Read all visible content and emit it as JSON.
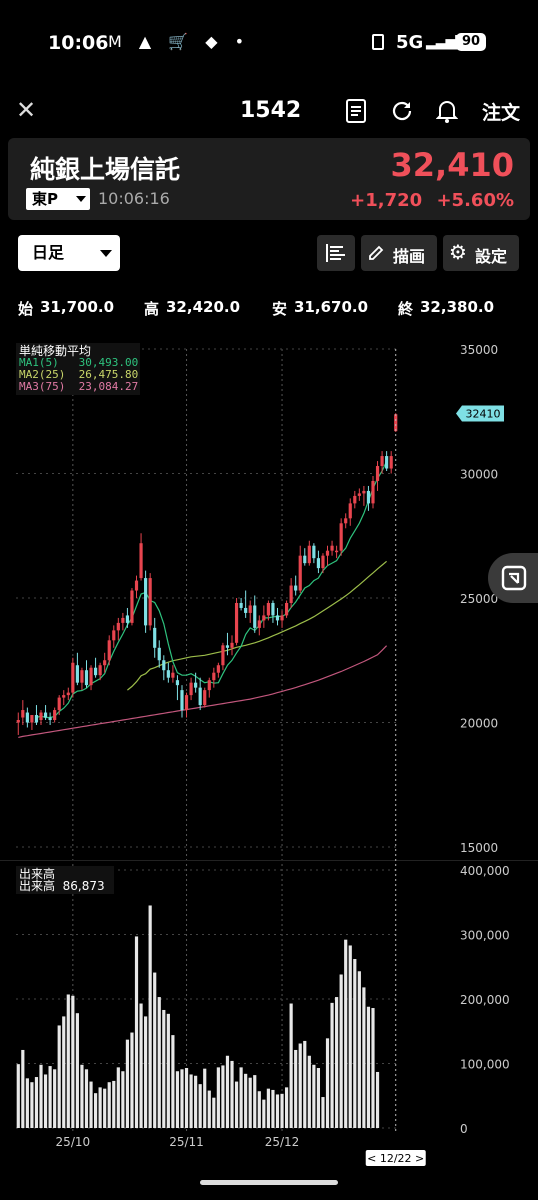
{
  "status_bar": {
    "time": "10:06",
    "network": "5G",
    "battery": "90"
  },
  "nav": {
    "code": "1542",
    "order_label": "注文"
  },
  "quote": {
    "name": "純銀上場信託",
    "price": "32,410",
    "change": "+1,720",
    "change_pct": "+5.60%",
    "market": "東P",
    "time": "10:06:16"
  },
  "toolbar": {
    "period": "日足",
    "draw_label": "描画",
    "settings_label": "設定"
  },
  "ohlc": {
    "open_label": "始",
    "open": "31,700.0",
    "high_label": "高",
    "high": "32,420.0",
    "low_label": "安",
    "low": "31,670.0",
    "close_label": "終",
    "close": "32,380.0"
  },
  "price_legend": {
    "title": "単純移動平均",
    "ma1": "MA1(5)   30,493.00",
    "ma2": "MA2(25)  26,475.80",
    "ma3": "MA3(75)  23,084.27"
  },
  "volume_legend": {
    "title": "出来高",
    "line": "出来高  86,873"
  },
  "price_tag": "32410",
  "date_tag": "< 12/22 >",
  "colors": {
    "up": "#e8454f",
    "down": "#7fe0e5",
    "ma1": "#2ec27e",
    "ma2": "#9cbd4a",
    "ma3": "#c2577d",
    "volume": "#e8e8e8"
  },
  "chart_data": {
    "type": "candlestick",
    "price_axis": {
      "ylim": [
        15000,
        35000
      ],
      "ticks": [
        "35000",
        "30000",
        "25000",
        "20000",
        "15000"
      ]
    },
    "volume_axis": {
      "ylim": [
        0,
        400000
      ],
      "ticks": [
        "400,000",
        "300,000",
        "200,000",
        "100,000",
        "0"
      ]
    },
    "x_ticks": [
      {
        "label": "25/10",
        "index": 12
      },
      {
        "label": "25/11",
        "index": 37
      },
      {
        "label": "25/12",
        "index": 58
      }
    ],
    "candles": [
      {
        "o": 20000,
        "h": 20400,
        "l": 19500,
        "c": 20100
      },
      {
        "o": 20200,
        "h": 20900,
        "l": 19900,
        "c": 20500
      },
      {
        "o": 20400,
        "h": 20600,
        "l": 19800,
        "c": 20000
      },
      {
        "o": 20000,
        "h": 20300,
        "l": 19700,
        "c": 20300
      },
      {
        "o": 20300,
        "h": 20700,
        "l": 19900,
        "c": 20000
      },
      {
        "o": 20100,
        "h": 20500,
        "l": 19900,
        "c": 20400
      },
      {
        "o": 20400,
        "h": 20700,
        "l": 20100,
        "c": 20200
      },
      {
        "o": 20200,
        "h": 20400,
        "l": 19900,
        "c": 20100
      },
      {
        "o": 20100,
        "h": 20600,
        "l": 20000,
        "c": 20500
      },
      {
        "o": 20500,
        "h": 21100,
        "l": 20300,
        "c": 21000
      },
      {
        "o": 21000,
        "h": 21300,
        "l": 20700,
        "c": 21100
      },
      {
        "o": 21100,
        "h": 21400,
        "l": 20900,
        "c": 21200
      },
      {
        "o": 21200,
        "h": 22600,
        "l": 21000,
        "c": 22400
      },
      {
        "o": 22300,
        "h": 22800,
        "l": 21500,
        "c": 21600
      },
      {
        "o": 21600,
        "h": 22200,
        "l": 21300,
        "c": 22100
      },
      {
        "o": 22100,
        "h": 22500,
        "l": 21400,
        "c": 21500
      },
      {
        "o": 21500,
        "h": 22300,
        "l": 21300,
        "c": 22200
      },
      {
        "o": 22200,
        "h": 22600,
        "l": 21800,
        "c": 21900
      },
      {
        "o": 21900,
        "h": 22400,
        "l": 21700,
        "c": 22300
      },
      {
        "o": 22300,
        "h": 22800,
        "l": 22000,
        "c": 22500
      },
      {
        "o": 22500,
        "h": 23500,
        "l": 22300,
        "c": 23300
      },
      {
        "o": 23300,
        "h": 23900,
        "l": 23000,
        "c": 23700
      },
      {
        "o": 23700,
        "h": 24200,
        "l": 23300,
        "c": 24000
      },
      {
        "o": 24000,
        "h": 24400,
        "l": 23700,
        "c": 24200
      },
      {
        "o": 24300,
        "h": 24600,
        "l": 23800,
        "c": 24000
      },
      {
        "o": 24000,
        "h": 25400,
        "l": 23900,
        "c": 25300
      },
      {
        "o": 25300,
        "h": 25900,
        "l": 25000,
        "c": 25700
      },
      {
        "o": 25800,
        "h": 27600,
        "l": 25700,
        "c": 27200
      },
      {
        "o": 25800,
        "h": 26100,
        "l": 23600,
        "c": 23900
      },
      {
        "o": 23900,
        "h": 26000,
        "l": 23700,
        "c": 25800
      },
      {
        "o": 23800,
        "h": 24200,
        "l": 22600,
        "c": 23000
      },
      {
        "o": 23000,
        "h": 23300,
        "l": 22200,
        "c": 22500
      },
      {
        "o": 22500,
        "h": 22700,
        "l": 21700,
        "c": 22100
      },
      {
        "o": 22100,
        "h": 22400,
        "l": 21600,
        "c": 21800
      },
      {
        "o": 21800,
        "h": 22300,
        "l": 21600,
        "c": 22000
      },
      {
        "o": 21700,
        "h": 21900,
        "l": 20900,
        "c": 21500
      },
      {
        "o": 21300,
        "h": 21500,
        "l": 20200,
        "c": 20500
      },
      {
        "o": 20500,
        "h": 21200,
        "l": 20200,
        "c": 21100
      },
      {
        "o": 21100,
        "h": 21800,
        "l": 20900,
        "c": 21600
      },
      {
        "o": 21600,
        "h": 22000,
        "l": 21200,
        "c": 21400
      },
      {
        "o": 21400,
        "h": 21800,
        "l": 20500,
        "c": 20700
      },
      {
        "o": 20700,
        "h": 21400,
        "l": 20600,
        "c": 21300
      },
      {
        "o": 21300,
        "h": 21800,
        "l": 21000,
        "c": 21700
      },
      {
        "o": 21700,
        "h": 22200,
        "l": 21400,
        "c": 22000
      },
      {
        "o": 22000,
        "h": 22400,
        "l": 21800,
        "c": 22300
      },
      {
        "o": 22300,
        "h": 23200,
        "l": 22100,
        "c": 23100
      },
      {
        "o": 23100,
        "h": 23600,
        "l": 22700,
        "c": 23000
      },
      {
        "o": 23000,
        "h": 23500,
        "l": 22700,
        "c": 23200
      },
      {
        "o": 23200,
        "h": 25000,
        "l": 23100,
        "c": 24800
      },
      {
        "o": 24800,
        "h": 25000,
        "l": 24500,
        "c": 24600
      },
      {
        "o": 24600,
        "h": 25300,
        "l": 24200,
        "c": 24400
      },
      {
        "o": 24400,
        "h": 24900,
        "l": 24000,
        "c": 24700
      },
      {
        "o": 24700,
        "h": 25100,
        "l": 23600,
        "c": 23800
      },
      {
        "o": 23800,
        "h": 24300,
        "l": 23500,
        "c": 24100
      },
      {
        "o": 24100,
        "h": 24700,
        "l": 23800,
        "c": 24300
      },
      {
        "o": 24300,
        "h": 24900,
        "l": 24100,
        "c": 24800
      },
      {
        "o": 24800,
        "h": 24900,
        "l": 24000,
        "c": 24300
      },
      {
        "o": 24300,
        "h": 24600,
        "l": 23900,
        "c": 24100
      },
      {
        "o": 24100,
        "h": 24500,
        "l": 23800,
        "c": 24300
      },
      {
        "o": 24300,
        "h": 24900,
        "l": 24200,
        "c": 24800
      },
      {
        "o": 24800,
        "h": 25800,
        "l": 24600,
        "c": 25500
      },
      {
        "o": 25500,
        "h": 25900,
        "l": 25100,
        "c": 25300
      },
      {
        "o": 25300,
        "h": 27100,
        "l": 25200,
        "c": 26700
      },
      {
        "o": 26700,
        "h": 27000,
        "l": 26300,
        "c": 26400
      },
      {
        "o": 26400,
        "h": 27300,
        "l": 26300,
        "c": 27100
      },
      {
        "o": 27100,
        "h": 27200,
        "l": 26400,
        "c": 26600
      },
      {
        "o": 26600,
        "h": 26900,
        "l": 26000,
        "c": 26200
      },
      {
        "o": 26200,
        "h": 26800,
        "l": 26000,
        "c": 26700
      },
      {
        "o": 26700,
        "h": 27100,
        "l": 26300,
        "c": 26900
      },
      {
        "o": 26900,
        "h": 27300,
        "l": 26700,
        "c": 27100
      },
      {
        "o": 26900,
        "h": 27100,
        "l": 26600,
        "c": 26900
      },
      {
        "o": 26900,
        "h": 28200,
        "l": 26700,
        "c": 28000
      },
      {
        "o": 28000,
        "h": 28400,
        "l": 27800,
        "c": 28200
      },
      {
        "o": 28200,
        "h": 29000,
        "l": 27900,
        "c": 28800
      },
      {
        "o": 28800,
        "h": 29300,
        "l": 28600,
        "c": 29100
      },
      {
        "o": 29100,
        "h": 29400,
        "l": 28900,
        "c": 29200
      },
      {
        "o": 29200,
        "h": 29500,
        "l": 28700,
        "c": 29300
      },
      {
        "o": 29300,
        "h": 29500,
        "l": 28500,
        "c": 28800
      },
      {
        "o": 28800,
        "h": 29900,
        "l": 28600,
        "c": 29700
      },
      {
        "o": 29700,
        "h": 30500,
        "l": 29300,
        "c": 30300
      },
      {
        "o": 30300,
        "h": 30900,
        "l": 30000,
        "c": 30700
      },
      {
        "o": 30700,
        "h": 30900,
        "l": 30100,
        "c": 30200
      },
      {
        "o": 30200,
        "h": 30900,
        "l": 30000,
        "c": 30700
      },
      {
        "o": 31700,
        "h": 32420,
        "l": 31670,
        "c": 32380
      }
    ],
    "volume": [
      99000,
      121000,
      77000,
      71000,
      79000,
      98000,
      83000,
      96000,
      91000,
      159000,
      173000,
      207000,
      205000,
      178000,
      98000,
      91000,
      72000,
      54000,
      63000,
      61000,
      71000,
      73000,
      94000,
      88000,
      137000,
      148000,
      297000,
      193000,
      173000,
      345000,
      241000,
      203000,
      183000,
      177000,
      144000,
      88000,
      91000,
      93000,
      83000,
      81000,
      68000,
      92000,
      58000,
      47000,
      94000,
      97000,
      112000,
      104000,
      72000,
      94000,
      84000,
      78000,
      82000,
      57000,
      44000,
      61000,
      59000,
      52000,
      53000,
      63000,
      193000,
      121000,
      131000,
      135000,
      112000,
      98000,
      93000,
      48000,
      139000,
      194000,
      203000,
      238000,
      292000,
      283000,
      262000,
      243000,
      218000,
      188000,
      186000,
      86873
    ],
    "ma1": [
      null,
      null,
      null,
      null,
      20200,
      20260,
      20200,
      20200,
      20240,
      20440,
      20580,
      20780,
      21140,
      21260,
      21280,
      21380,
      21560,
      21660,
      21760,
      21960,
      22440,
      22860,
      23220,
      23560,
      23920,
      24200,
      24680,
      25160,
      25220,
      24900,
      24820,
      24480,
      23960,
      23160,
      22440,
      22000,
      21900,
      21900,
      21960,
      21860,
      21720,
      21600,
      21640,
      21580,
      21600,
      21960,
      22300,
      22500,
      22800,
      23060,
      23540,
      23800,
      23700,
      23900,
      24200,
      24200,
      24240,
      24260,
      24260,
      24360,
      24620,
      24840,
      25120,
      25400,
      25500,
      25700,
      25800,
      26100,
      26300,
      26400,
      26500,
      26800,
      27000,
      27400,
      27700,
      28000,
      28400,
      28900,
      29400,
      29800,
      30100,
      30493
    ],
    "ma2": [
      null,
      null,
      null,
      null,
      null,
      null,
      null,
      null,
      null,
      null,
      null,
      null,
      null,
      null,
      null,
      null,
      null,
      null,
      null,
      null,
      null,
      null,
      null,
      null,
      21300,
      21450,
      21640,
      21880,
      21960,
      22140,
      22200,
      22280,
      22360,
      22420,
      22480,
      22520,
      22560,
      22600,
      22640,
      22660,
      22680,
      22700,
      22740,
      22780,
      22820,
      22860,
      22900,
      22960,
      23020,
      23060,
      23100,
      23150,
      23200,
      23260,
      23330,
      23400,
      23480,
      23560,
      23640,
      23720,
      23800,
      23880,
      23970,
      24060,
      24150,
      24250,
      24360,
      24480,
      24600,
      24720,
      24840,
      24960,
      25090,
      25230,
      25380,
      25530,
      25690,
      25850,
      26010,
      26170,
      26320,
      26475.8
    ],
    "ma3": [
      19400,
      19440,
      19470,
      19500,
      19530,
      19560,
      19590,
      19620,
      19650,
      19680,
      19710,
      19740,
      19770,
      19800,
      19830,
      19860,
      19890,
      19920,
      19950,
      19980,
      20010,
      20040,
      20070,
      20100,
      20130,
      20160,
      20190,
      20220,
      20250,
      20280,
      20310,
      20340,
      20370,
      20400,
      20430,
      20460,
      20490,
      20520,
      20550,
      20580,
      20610,
      20640,
      20670,
      20700,
      20730,
      20760,
      20790,
      20820,
      20850,
      20880,
      20910,
      20940,
      20980,
      21020,
      21060,
      21100,
      21150,
      21200,
      21250,
      21300,
      21350,
      21400,
      21460,
      21520,
      21580,
      21640,
      21700,
      21770,
      21840,
      21910,
      21980,
      22050,
      22130,
      22210,
      22290,
      22370,
      22450,
      22540,
      22630,
      22720,
      22900,
      23084.27
    ]
  }
}
